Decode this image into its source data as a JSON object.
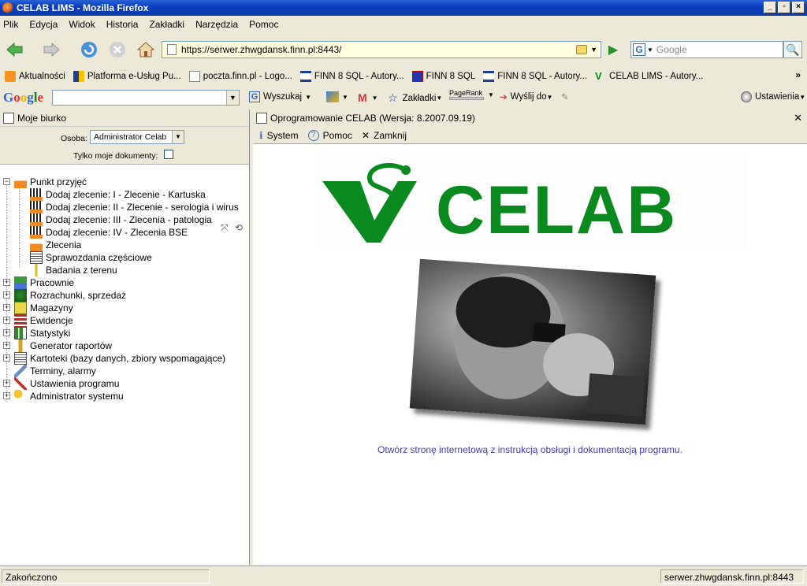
{
  "window": {
    "title": "CELAB LIMS - Mozilla Firefox"
  },
  "menu": [
    "Plik",
    "Edycja",
    "Widok",
    "Historia",
    "Zakładki",
    "Narzędzia",
    "Pomoc"
  ],
  "nav": {
    "url": "https://serwer.zhwgdansk.finn.pl:8443/",
    "search_placeholder": "Google"
  },
  "bookmarks": [
    {
      "label": "Aktualności",
      "icon": "rss-icon"
    },
    {
      "label": "Platforma e-Usług Pu...",
      "icon": "bookmark-icon"
    },
    {
      "label": "poczta.finn.pl - Logo...",
      "icon": "page-icon"
    },
    {
      "label": "FINN 8 SQL - Autory...",
      "icon": "building-icon"
    },
    {
      "label": "FINN 8 SQL",
      "icon": "finn-icon"
    },
    {
      "label": "FINN 8 SQL - Autory...",
      "icon": "building-icon"
    },
    {
      "label": "CELAB LIMS - Autory...",
      "icon": "celab-icon"
    }
  ],
  "google_toolbar": {
    "logo": "Google",
    "search": "Wyszukaj",
    "bookmarks": "Zakładki",
    "pagerank": "PageRank",
    "send": "Wyślij do",
    "settings": "Ustawienia"
  },
  "left_panel": {
    "title": "Moje biurko",
    "person_label": "Osoba:",
    "person_value": "Administrator Celab",
    "only_mine_label": "Tylko moje dokumenty:",
    "tree": [
      {
        "label": "Punkt przyjęć",
        "level": 0,
        "state": "-",
        "icon": "flask-icon"
      },
      {
        "label": "Dodaj zlecenie: I - Zlecenie - Kartuska",
        "level": 1,
        "icon": "order-icon"
      },
      {
        "label": "Dodaj zlecenie: II - Zlecenie - serologia i wirus",
        "level": 1,
        "icon": "order-icon"
      },
      {
        "label": "Dodaj zlecenie: III - Zlecenia - patologia",
        "level": 1,
        "icon": "order-icon"
      },
      {
        "label": "Dodaj zlecenie: IV - Zlecenia BSE",
        "level": 1,
        "icon": "order-icon"
      },
      {
        "label": "Zlecenia",
        "level": 1,
        "icon": "flask-icon"
      },
      {
        "label": "Sprawozdania częściowe",
        "level": 1,
        "icon": "report-icon"
      },
      {
        "label": "Badania z terenu",
        "level": 1,
        "icon": "test-tube-icon"
      },
      {
        "label": "Pracownie",
        "level": 0,
        "state": "+",
        "icon": "lab-icon"
      },
      {
        "label": "Rozrachunki, sprzedaż",
        "level": 0,
        "state": "+",
        "icon": "money-icon"
      },
      {
        "label": "Magazyny",
        "level": 0,
        "state": "+",
        "icon": "warehouse-icon"
      },
      {
        "label": "Ewidencje",
        "level": 0,
        "state": "+",
        "icon": "records-icon"
      },
      {
        "label": "Statystyki",
        "level": 0,
        "state": "+",
        "icon": "stats-icon"
      },
      {
        "label": "Generator raportów",
        "level": 0,
        "state": "+",
        "icon": "generator-icon"
      },
      {
        "label": "Kartoteki (bazy danych, zbiory wspomagające)",
        "level": 0,
        "state": "+",
        "icon": "database-icon"
      },
      {
        "label": "Terminy, alarmy",
        "level": 0,
        "icon": "alarm-icon"
      },
      {
        "label": "Ustawienia programu",
        "level": 0,
        "state": "+",
        "icon": "tools-icon"
      },
      {
        "label": "Administrator systemu",
        "level": 0,
        "state": "+",
        "icon": "admin-icon"
      }
    ]
  },
  "right_panel": {
    "title": "Oprogramowanie CELAB (Wersja: 8.2007.09.19)",
    "toolbar": [
      "System",
      "Pomoc",
      "Zamknij"
    ],
    "logo_text": "CELAB",
    "link_text": "Otwórz stronę internetową z instrukcją obsługi i dokumentacją programu."
  },
  "status": {
    "left": "Zakończono",
    "right": "serwer.zhwgdansk.finn.pl:8443"
  },
  "colors": {
    "logo_green": "#0a8a1e",
    "link_blue": "#3c3ccc",
    "title_blue": "#0a3ec0"
  }
}
